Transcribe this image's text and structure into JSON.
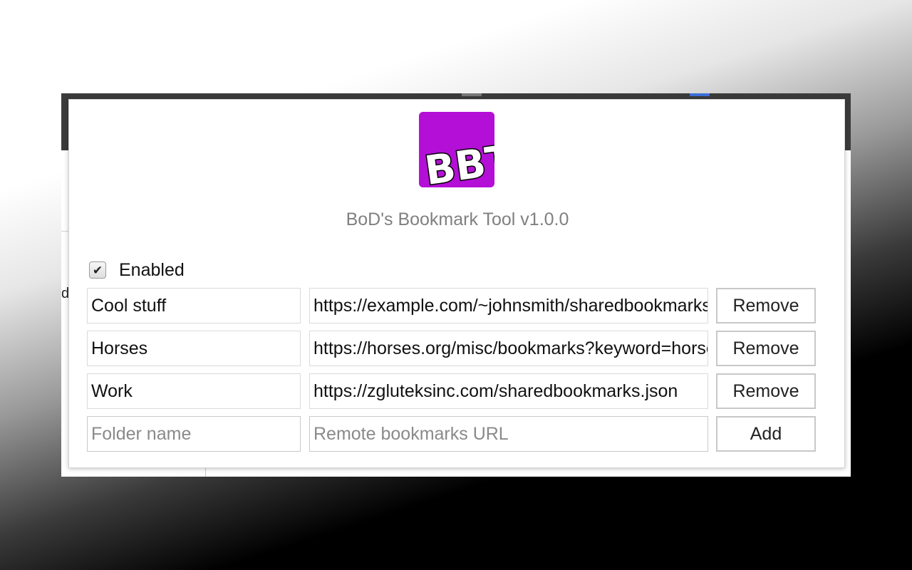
{
  "app": {
    "title": "BoD's Bookmark Tool v1.0.0",
    "logo_text": "BBT",
    "logo_color": "#b40fd6"
  },
  "enabled": {
    "label": "Enabled",
    "checked": true,
    "check_glyph": "✔"
  },
  "bookmarks": [
    {
      "folder": "Cool stuff",
      "url": "https://example.com/~johnsmith/sharedbookmarks.json",
      "action": "Remove"
    },
    {
      "folder": "Horses",
      "url": "https://horses.org/misc/bookmarks?keyword=horses",
      "action": "Remove"
    },
    {
      "folder": "Work",
      "url": "https://zgluteksinc.com/sharedbookmarks.json",
      "action": "Remove"
    }
  ],
  "new_entry": {
    "folder_placeholder": "Folder name",
    "url_placeholder": "Remote bookmarks URL",
    "action": "Add"
  },
  "background_page": {
    "peek_text": "d"
  }
}
